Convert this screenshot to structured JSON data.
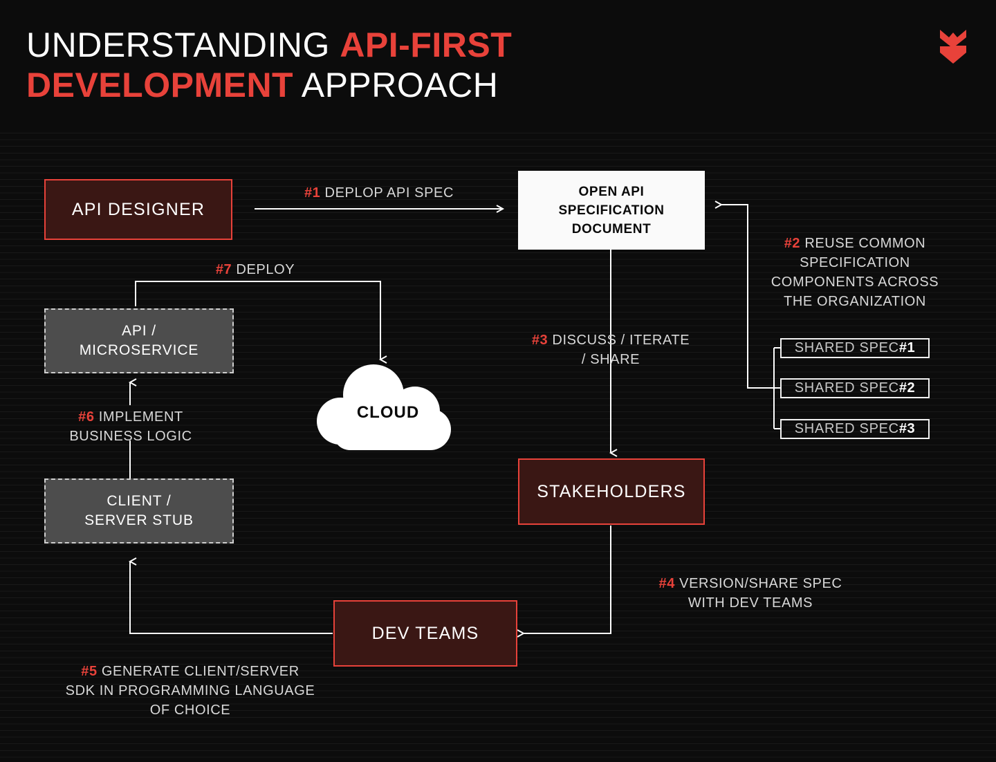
{
  "header": {
    "title_parts": [
      {
        "text": "UNDERSTANDING ",
        "accent": false
      },
      {
        "text": "API-FIRST",
        "accent": true
      },
      {
        "text": " ",
        "accent": false
      },
      {
        "text": "DEVELOPMENT",
        "accent": true
      },
      {
        "text": " APPROACH",
        "accent": false
      }
    ],
    "title_line1_plain": "UNDERSTANDING ",
    "title_line1_accent": "API-FIRST",
    "title_line2_accent": "DEVELOPMENT",
    "title_line2_plain": " APPROACH",
    "logo_name": "shield-s-logo"
  },
  "colors": {
    "background": "#0c0c0c",
    "accent_red": "#e8423a",
    "node_red_fill": "#3a1714",
    "node_gray_fill": "#4d4d4d",
    "node_gray_border": "#cfcfcf",
    "white": "#fafafa",
    "caption_text": "#d8d8d8"
  },
  "nodes": {
    "api_designer": "API DESIGNER",
    "open_api_doc_line1": "OPEN API",
    "open_api_doc_line2": "SPECIFICATION",
    "open_api_doc_line3": "DOCUMENT",
    "api_microservice_line1": "API /",
    "api_microservice_line2": "MICROSERVICE",
    "client_server_stub_line1": "CLIENT /",
    "client_server_stub_line2": "SERVER STUB",
    "cloud": "CLOUD",
    "stakeholders": "STAKEHOLDERS",
    "dev_teams": "DEV TEAMS"
  },
  "shared_specs": [
    {
      "label": "SHARED SPEC ",
      "number": "#1"
    },
    {
      "label": "SHARED SPEC ",
      "number": "#2"
    },
    {
      "label": "SHARED SPEC ",
      "number": "#3"
    }
  ],
  "steps": {
    "step1": {
      "num": "#1",
      "text": " DEPLOP API SPEC"
    },
    "step2": {
      "num": "#2",
      "text": " REUSE COMMON\nSPECIFICATION\nCOMPONENTS ACROSS\nTHE ORGANIZATION"
    },
    "step3": {
      "num": "#3",
      "text": " DISCUSS / ITERATE\n/ SHARE"
    },
    "step4": {
      "num": "#4",
      "text": " VERSION/SHARE SPEC\nWITH DEV TEAMS"
    },
    "step5": {
      "num": "#5",
      "text": " GENERATE CLIENT/SERVER\nSDK IN PROGRAMMING LANGUAGE\nOF CHOICE"
    },
    "step6": {
      "num": "#6",
      "text": " IMPLEMENT\nBUSINESS LOGIC"
    },
    "step7": {
      "num": "#7",
      "text": " DEPLOY"
    }
  }
}
